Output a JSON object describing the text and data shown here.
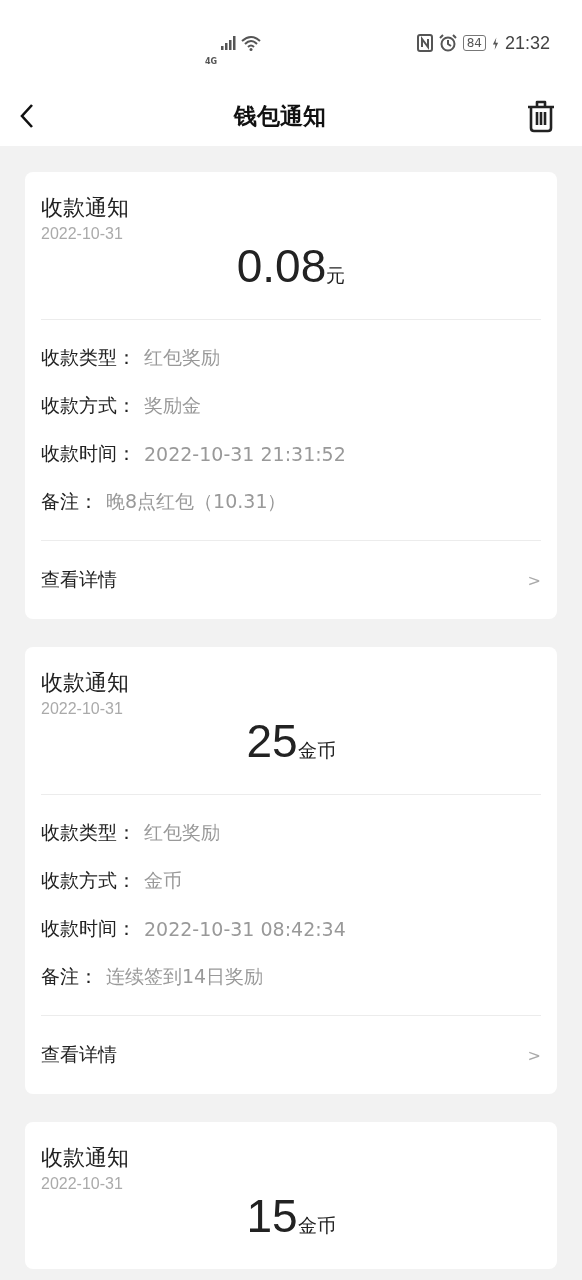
{
  "status_bar": {
    "network": "4G",
    "battery": "84",
    "time": "21:32"
  },
  "header": {
    "title": "钱包通知"
  },
  "cards": [
    {
      "title": "收款通知",
      "date": "2022-10-31",
      "amount": "0.08",
      "unit": "元",
      "fields": [
        {
          "label": "收款类型：",
          "value": "红包奖励"
        },
        {
          "label": "收款方式：",
          "value": "奖励金"
        },
        {
          "label": "收款时间：",
          "value": "2022-10-31 21:31:52"
        },
        {
          "label": "备注：",
          "value": "晚8点红包（10.31）"
        }
      ],
      "link": "查看详情",
      "chevron": ">"
    },
    {
      "title": "收款通知",
      "date": "2022-10-31",
      "amount": "25",
      "unit": "金币",
      "fields": [
        {
          "label": "收款类型：",
          "value": "红包奖励"
        },
        {
          "label": "收款方式：",
          "value": "金币"
        },
        {
          "label": "收款时间：",
          "value": "2022-10-31 08:42:34"
        },
        {
          "label": "备注：",
          "value": "连续签到14日奖励"
        }
      ],
      "link": "查看详情",
      "chevron": ">"
    },
    {
      "title": "收款通知",
      "date": "2022-10-31",
      "amount": "15",
      "unit": "金币"
    }
  ]
}
